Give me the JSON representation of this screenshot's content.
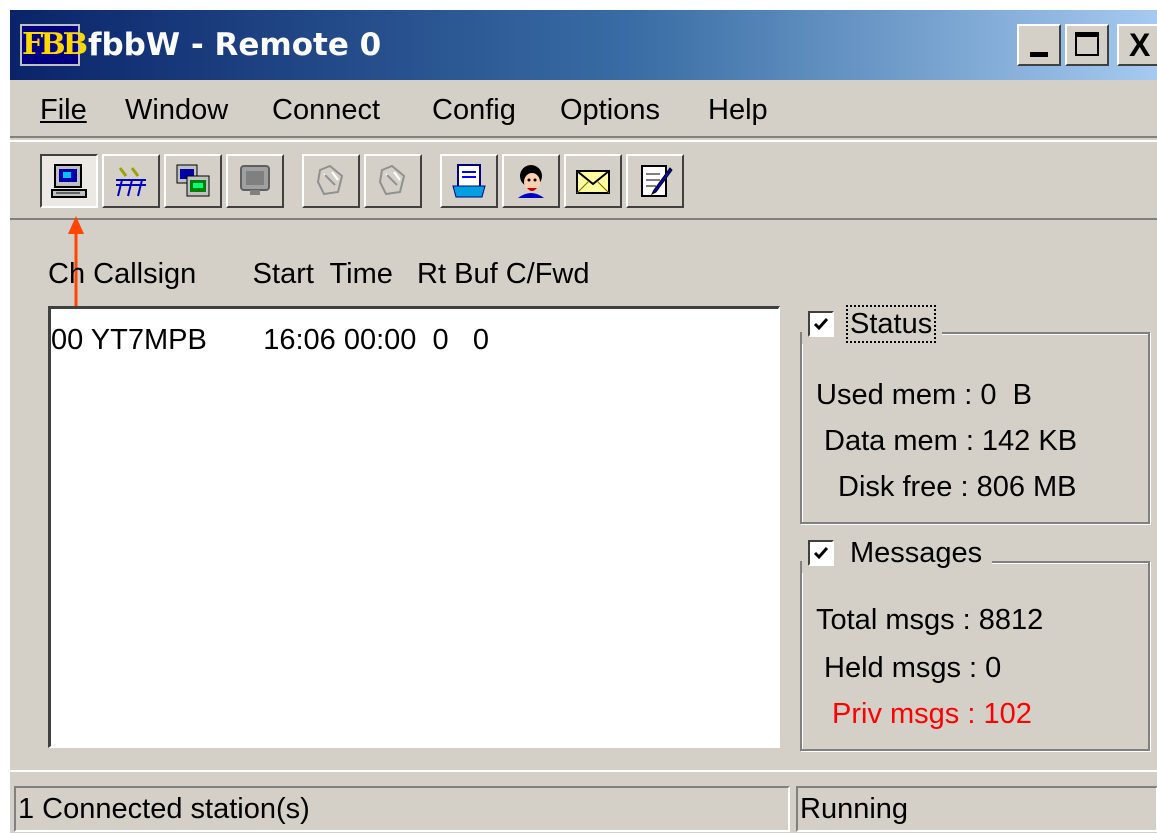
{
  "window": {
    "logo_text": "FBB",
    "title": "fbbW - Remote 0",
    "controls": {
      "minimize_icon": "minimize-icon",
      "maximize_icon": "maximize-icon",
      "close_glyph": "X"
    }
  },
  "menu": [
    "File",
    "Window",
    "Connect",
    "Config",
    "Options",
    "Help"
  ],
  "toolbar": {
    "buttons": [
      {
        "icon": "computer-monitor-icon",
        "state": "pressed"
      },
      {
        "icon": "antenna-ports-icon",
        "state": "normal"
      },
      {
        "icon": "cascade-windows-icon",
        "state": "normal"
      },
      {
        "icon": "monitor-off-icon",
        "state": "normal"
      },
      {
        "icon": "disabled-tool-icon",
        "state": "disabled"
      },
      {
        "icon": "disabled-tool-icon",
        "state": "disabled"
      },
      {
        "icon": "message-editor-icon",
        "state": "normal"
      },
      {
        "icon": "user-face-icon",
        "state": "normal"
      },
      {
        "icon": "envelope-icon",
        "state": "normal"
      },
      {
        "icon": "notepad-edit-icon",
        "state": "normal"
      }
    ]
  },
  "annotation": {
    "arrow_color": "#ff4500"
  },
  "channel_list": {
    "header": "Ch Callsign       Start  Time   Rt Buf C/Fwd",
    "rows": [
      {
        "text": "00 YT7MPB       16:06 00:00  0   0"
      }
    ]
  },
  "status_panel": {
    "label": "Status",
    "checked": true,
    "used_mem": "Used mem : 0  B",
    "data_mem": "Data mem : 142 KB",
    "disk_free": "Disk free : 806 MB"
  },
  "messages_panel": {
    "label": "Messages",
    "checked": true,
    "total": "Total msgs : 8812",
    "held": "Held msgs : 0",
    "priv": "Priv msgs : 102",
    "priv_color": "#ff0000"
  },
  "statusbar": {
    "left": "1 Connected station(s)",
    "right": "Running"
  }
}
